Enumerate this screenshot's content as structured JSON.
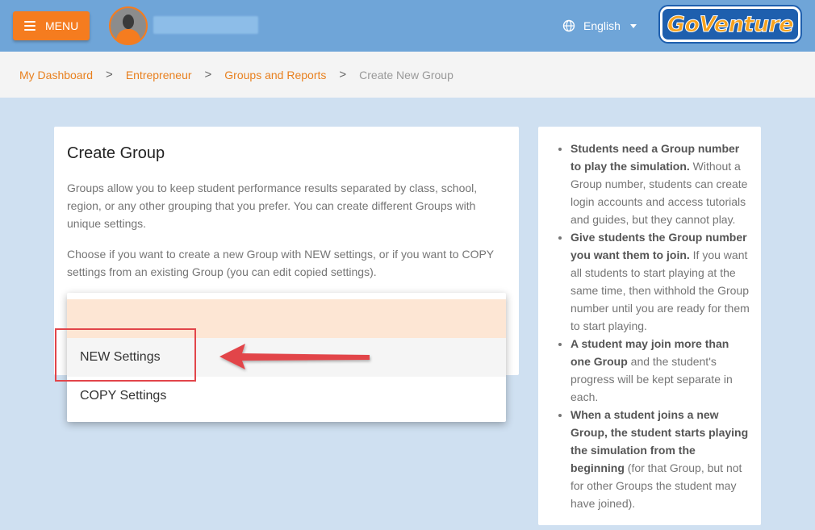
{
  "header": {
    "menu_label": "MENU",
    "language": "English",
    "logo_text": "GoVenture"
  },
  "breadcrumb": {
    "items": [
      "My Dashboard",
      "Entrepreneur",
      "Groups and Reports"
    ],
    "current": "Create New Group",
    "separator": ">"
  },
  "create_group": {
    "title": "Create Group",
    "paragraph1": "Groups allow you to keep student performance results separated by class, school, region, or any other grouping that you prefer. You can create different Groups with unique settings.",
    "paragraph2": "Choose if you want to create a new Group with NEW settings, or if you want to COPY settings from an existing Group (you can edit copied settings)."
  },
  "settings_dropdown": {
    "options": [
      "",
      "NEW Settings",
      "COPY Settings"
    ],
    "highlighted": "NEW Settings"
  },
  "info": {
    "items": [
      {
        "bold": "Students need a Group number to play the simulation.",
        "text": " Without a Group number, students can create login accounts and access tutorials and guides, but they cannot play."
      },
      {
        "bold": "Give students the Group number you want them to join.",
        "text": " If you want all students to start playing at the same time, then withhold the Group number until you are ready for them to start playing."
      },
      {
        "bold": "A student may join more than one Group",
        "text": " and the student's progress will be kept separate in each."
      },
      {
        "bold": "When a student joins a new Group, the student starts playing the simulation from the beginning",
        "text": " (for that Group, but not for other Groups the student may have joined)."
      }
    ]
  },
  "colors": {
    "topbar": "#6fa5d8",
    "accent_orange": "#f57c1f",
    "page_bg": "#cfe0f1",
    "annotation_red": "#e2454a"
  }
}
